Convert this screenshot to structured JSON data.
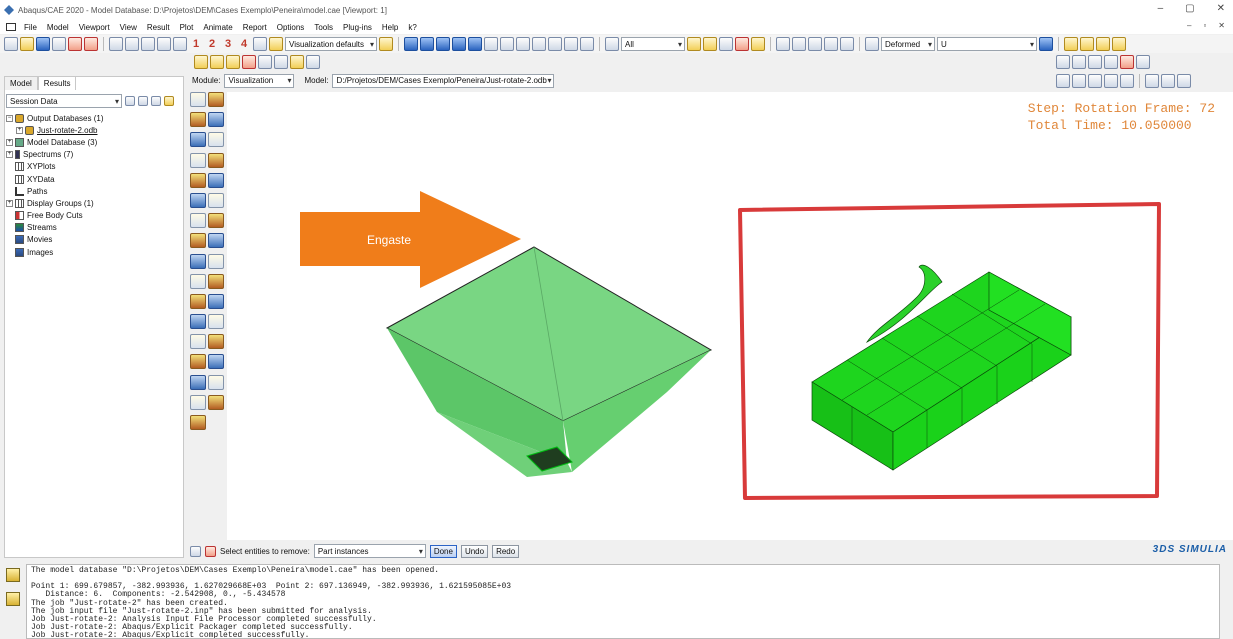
{
  "window": {
    "title": "Abaqus/CAE 2020 - Model Database: D:\\Projetos\\DEM\\Cases Exemplo\\Peneira\\model.cae [Viewport: 1]",
    "controls": [
      "–",
      "▢",
      "✕"
    ]
  },
  "menubar": {
    "items": [
      "File",
      "Model",
      "Viewport",
      "View",
      "Result",
      "Plot",
      "Animate",
      "Report",
      "Options",
      "Tools",
      "Plug-ins",
      "Help",
      "k?"
    ],
    "right_controls": [
      "–",
      "▫",
      "✕"
    ]
  },
  "toolbar": {
    "numbers": [
      "1",
      "2",
      "3",
      "4"
    ],
    "vis_defaults": "Visualization defaults",
    "all_select": "All",
    "deformed_select": "Deformed",
    "variable_select": "U"
  },
  "context": {
    "module_label": "Module:",
    "module_value": "Visualization",
    "model_label": "Model:",
    "model_value": "D:/Projetos/DEM/Cases Exemplo/Peneira/Just-rotate-2.odb"
  },
  "left_panel": {
    "tabs": [
      "Model",
      "Results"
    ],
    "active_tab": "Results",
    "session_select": "Session Data",
    "tree": [
      {
        "label": "Output Databases (1)",
        "icon": "db",
        "expander": "−",
        "indent": 0,
        "underline": false
      },
      {
        "label": "Just-rotate-2.odb",
        "icon": "db",
        "expander": "+",
        "indent": 1,
        "underline": true
      },
      {
        "label": "Model Database (3)",
        "icon": "mdl",
        "expander": "+",
        "indent": 0,
        "underline": false
      },
      {
        "label": "Spectrums (7)",
        "icon": "spec",
        "expander": "+",
        "indent": 0,
        "underline": false
      },
      {
        "label": "XYPlots",
        "icon": "grid",
        "expander": "",
        "indent": 0,
        "underline": false
      },
      {
        "label": "XYData",
        "icon": "grid",
        "expander": "",
        "indent": 0,
        "underline": false
      },
      {
        "label": "Paths",
        "icon": "path",
        "expander": "",
        "indent": 0,
        "underline": false
      },
      {
        "label": "Display Groups (1)",
        "icon": "grid",
        "expander": "+",
        "indent": 0,
        "underline": false
      },
      {
        "label": "Free Body Cuts",
        "icon": "fbc",
        "expander": "",
        "indent": 0,
        "underline": false
      },
      {
        "label": "Streams",
        "icon": "stream",
        "expander": "",
        "indent": 0,
        "underline": false
      },
      {
        "label": "Movies",
        "icon": "img",
        "expander": "",
        "indent": 0,
        "underline": false
      },
      {
        "label": "Images",
        "icon": "img",
        "expander": "",
        "indent": 0,
        "underline": false
      }
    ]
  },
  "viewport": {
    "step_line": "Step: Rotation Frame: 72",
    "time_line": "Total Time: 10.050000",
    "annotation_label": "Engaste",
    "colors": {
      "arrow": "#f07d1a",
      "hopper": "#5fcf6b",
      "mesh": "#1fd81f",
      "box": "#d83a3a"
    }
  },
  "prompt": {
    "label": "Select entities to remove:",
    "select_value": "Part instances",
    "buttons": [
      "Done",
      "Undo",
      "Redo"
    ]
  },
  "brand": "3DS SIMULIA",
  "messages": [
    "The model database \"D:\\Projetos\\DEM\\Cases Exemplo\\Peneira\\model.cae\" has been opened.",
    "",
    "Point 1: 699.679857, -382.993936, 1.627029668E+03  Point 2: 697.136949, -382.993936, 1.621595085E+03",
    "   Distance: 6.  Components: -2.542908, 0., -5.434578",
    "The job \"Just-rotate-2\" has been created.",
    "The job input file \"Just-rotate-2.inp\" has been submitted for analysis.",
    "Job Just-rotate-2: Analysis Input File Processor completed successfully.",
    "Job Just-rotate-2: Abaqus/Explicit Packager completed successfully.",
    "Job Just-rotate-2: Abaqus/Explicit completed successfully."
  ]
}
